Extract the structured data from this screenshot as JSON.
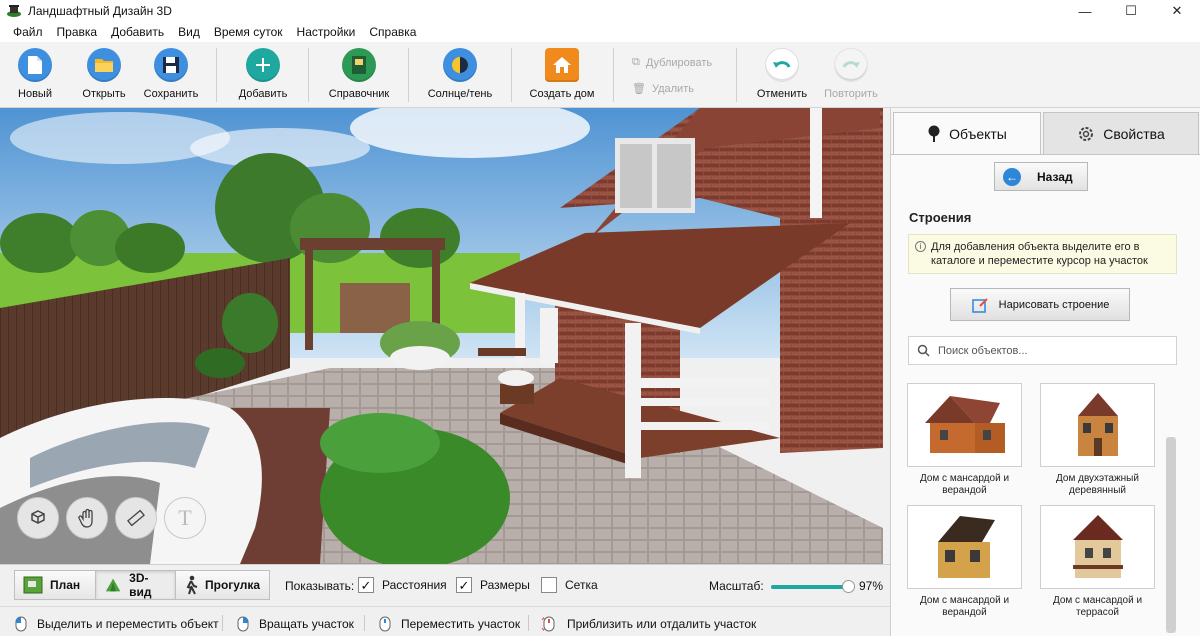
{
  "window": {
    "title": "Ландшафтный Дизайн 3D",
    "minimize": "—",
    "maximize": "☐",
    "close": "✕"
  },
  "menu": [
    "Файл",
    "Правка",
    "Добавить",
    "Вид",
    "Время суток",
    "Настройки",
    "Справка"
  ],
  "toolbar": {
    "new": "Новый",
    "open": "Открыть",
    "save": "Сохранить",
    "add": "Добавить",
    "reference": "Справочник",
    "sun_shadow": "Солнце/тень",
    "create_house": "Создать дом",
    "duplicate": "Дублировать",
    "delete": "Удалить",
    "undo": "Отменить",
    "redo": "Повторить"
  },
  "view_tabs": {
    "plan": "План",
    "view3d": "3D-вид",
    "walk": "Прогулка",
    "active": "3D-вид"
  },
  "show": {
    "label": "Показывать:",
    "distances": {
      "label": "Расстояния",
      "checked": true
    },
    "sizes": {
      "label": "Размеры",
      "checked": true
    },
    "grid": {
      "label": "Сетка",
      "checked": false
    }
  },
  "zoom": {
    "label": "Масштаб:",
    "value": "97%",
    "fraction": 0.97
  },
  "status": {
    "select_move": "Выделить и переместить объект",
    "rotate": "Вращать участок",
    "move_plot": "Переместить участок",
    "zoom": "Приблизить или отдалить участок"
  },
  "panel": {
    "tab_objects": "Объекты",
    "tab_properties": "Свойства",
    "back": "Назад",
    "section": "Строения",
    "hint": "Для добавления объекта выделите его в каталоге и переместите курсор на участок",
    "draw_building": "Нарисовать строение",
    "search_placeholder": "Поиск объектов...",
    "items": [
      {
        "name": "Дом с мансардой и верандой"
      },
      {
        "name": "Дом двухэтажный деревянный"
      },
      {
        "name": "Дом с мансардой и верандой"
      },
      {
        "name": "Дом с мансардой и террасой"
      }
    ]
  },
  "colors": {
    "accent_teal": "#1fa8a0",
    "accent_blue": "#2d86d8",
    "roof_brown": "#7a3a2a",
    "brick": "#8a4436"
  }
}
